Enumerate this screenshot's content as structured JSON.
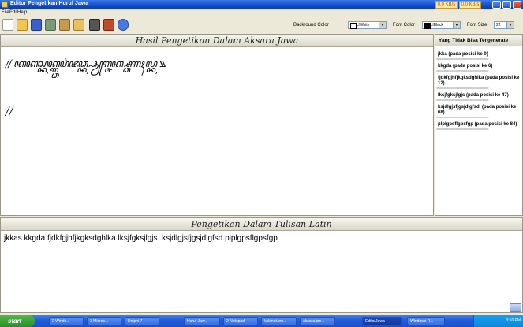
{
  "window": {
    "title": "Editor Pengetikan Huruf Jawa",
    "net_down": "0.0 KB/s",
    "net_up": "0.0 KB/s"
  },
  "menu": [
    "File",
    "Edit",
    "Help"
  ],
  "toolbar": {
    "background_color_label": "Backround Color",
    "background_color_value": "clWhite",
    "font_color_label": "Font Color",
    "font_color_value": "clBlack",
    "font_size_label": "Font Size",
    "font_size_value": "22"
  },
  "main_panel": {
    "title": "Hasil Pengetikan Dalam Aksara Jawa",
    "javanese_line1": "// ꦏꦏꦱ꧀ꦏꦏ꧀ꦒ꧀ꦣꦥ꦳ꦗꦣ꧀ꦏ꧀ꦦꦾꦒ꧀ꦗꦏ꧀ꦱ꧀ꦣꦒꦃꦭ꧀ꦏ ꧉",
    "javanese_line2": "//"
  },
  "side_panel": {
    "title": "Yang Tidak Bisa Tergenerate",
    "items": [
      {
        "text": "jkka    (pada posisi ke 0)"
      },
      {
        "text": "kkgda    (pada posisi ke 6)"
      },
      {
        "text": "fjdkfgjhfjkgksdghlka    (pada posisi ke 12)"
      },
      {
        "text": "lksjfgksjlgjs    (pada posisi ke 47)"
      },
      {
        "text": "ksjdlgjsfjgsjdlgfsd.    (pada posisi ke 68)"
      },
      {
        "text": "plplgpsflgpsfgp    (pada posisi ke 84)"
      }
    ],
    "separator": "======================"
  },
  "latin_panel": {
    "title": "Pengetikan Dalam Tulisan Latin",
    "text": "jkkas.kkgda.fjdkfgjhfjkgksdghlka.lksjfgksjlgjs .ksjdlgjsfjgsjdlgfsd.plplgpsflgpsfgp"
  },
  "taskbar": {
    "start_label": "start",
    "tasks": [
      {
        "label": "2 Windo..."
      },
      {
        "label": "3 Micros..."
      },
      {
        "label": "Delphi 7"
      },
      {
        "label": "Huruf Jaw..."
      },
      {
        "label": "2 Notepad"
      },
      {
        "label": "kalimat.bm..."
      },
      {
        "label": "aksara.bm..."
      },
      {
        "label": "EditorJawa"
      },
      {
        "label": "Windows R..."
      }
    ],
    "clock": "3:56 PM"
  },
  "colors": {
    "titlebar": "#1048c8",
    "taskbar": "#245edb",
    "start_button": "#2a8f2a"
  }
}
